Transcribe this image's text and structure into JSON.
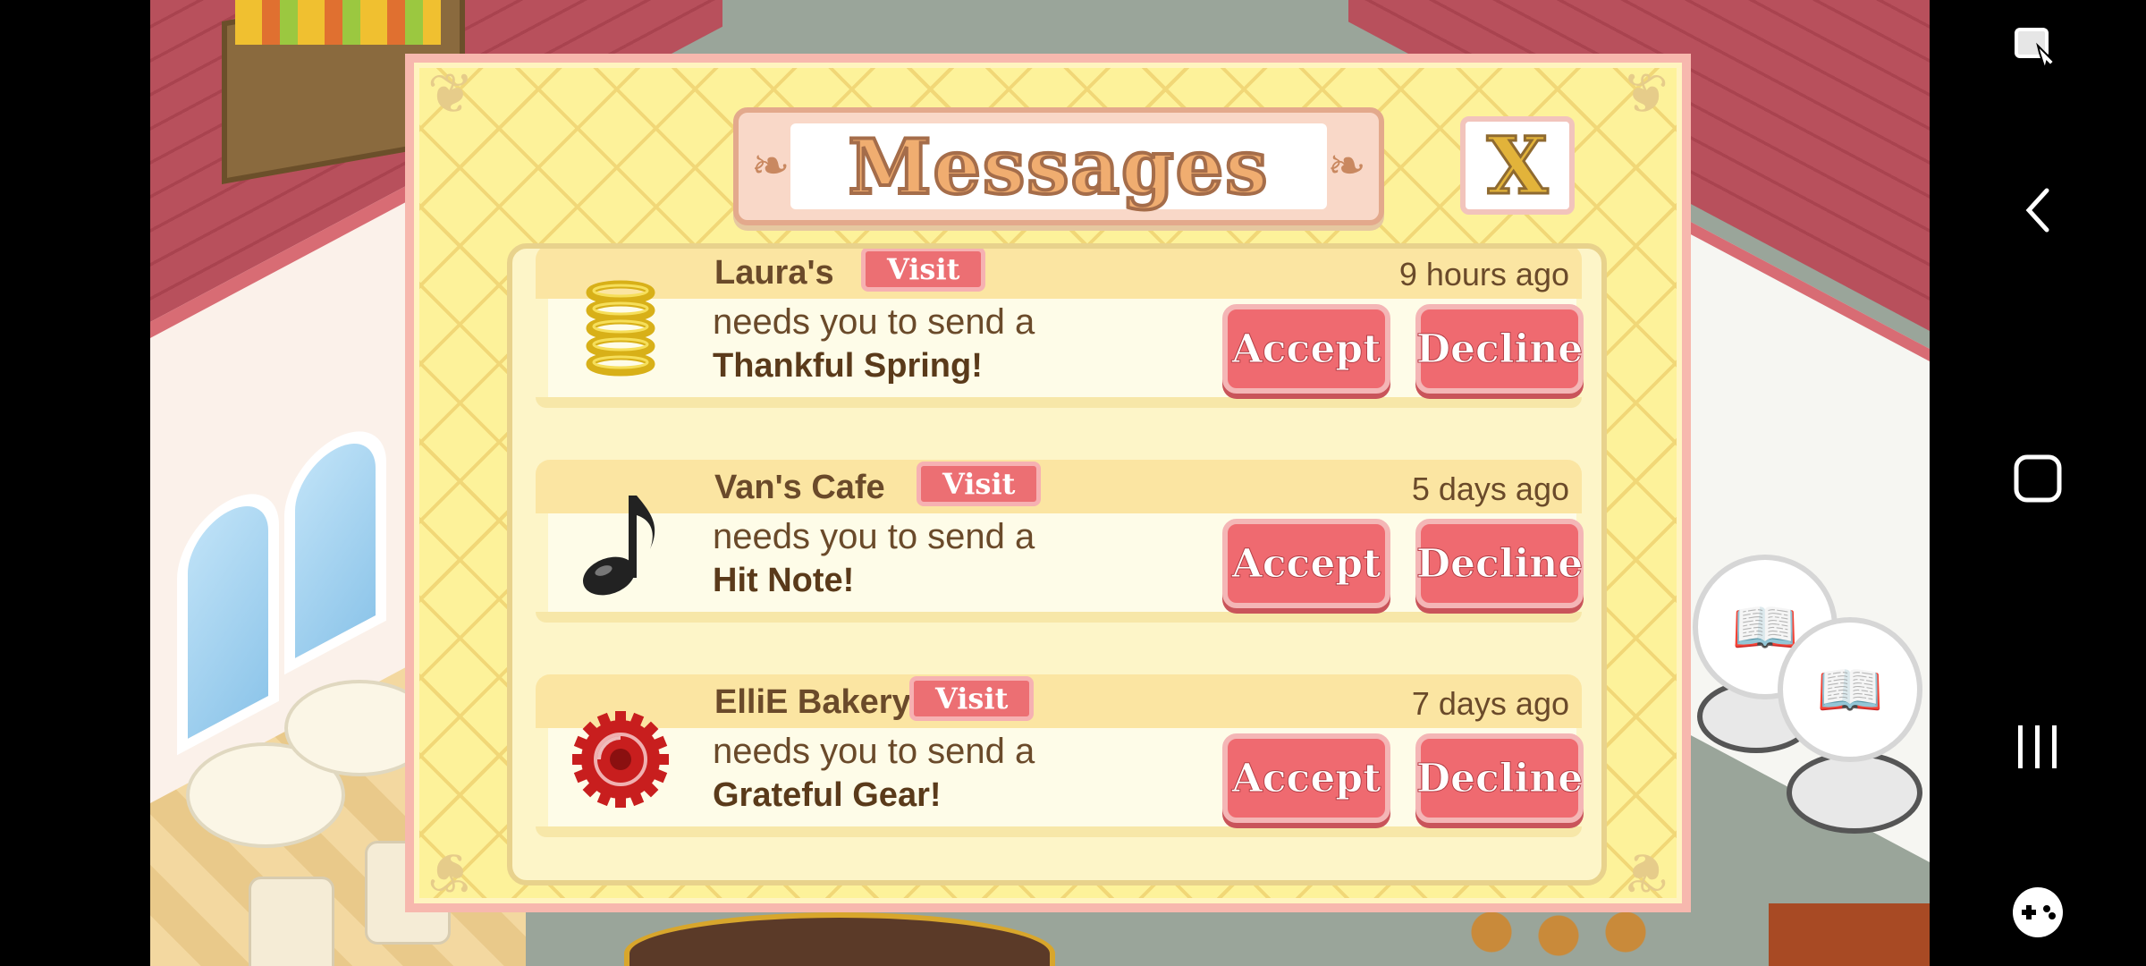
{
  "dialog": {
    "title": "Messages",
    "close_label": "X"
  },
  "messages": [
    {
      "sender": "Laura's",
      "visit_label": "Visit",
      "time": "9 hours ago",
      "line1": "needs you to send a",
      "item": "Thankful Spring!",
      "icon": "spring-icon",
      "accept_label": "Accept",
      "decline_label": "Decline"
    },
    {
      "sender": "Van's Cafe",
      "visit_label": "Visit",
      "time": "5 days ago",
      "line1": "needs you to send a",
      "item": "Hit Note!",
      "icon": "music-note-icon",
      "accept_label": "Accept",
      "decline_label": "Decline"
    },
    {
      "sender": "ElliE Bakery",
      "visit_label": "Visit",
      "time": "7 days ago",
      "line1": "needs you to send a",
      "item": "Grateful Gear!",
      "icon": "gear-icon",
      "accept_label": "Accept",
      "decline_label": "Decline"
    }
  ],
  "system_nav": {
    "icons": [
      "screen-lock-icon",
      "back-icon",
      "home-icon",
      "recents-icon",
      "gamepad-icon"
    ]
  },
  "colors": {
    "button_red": "#ef6a70",
    "dialog_yellow": "#fdf29a",
    "text_brown": "#6a4a2a"
  }
}
